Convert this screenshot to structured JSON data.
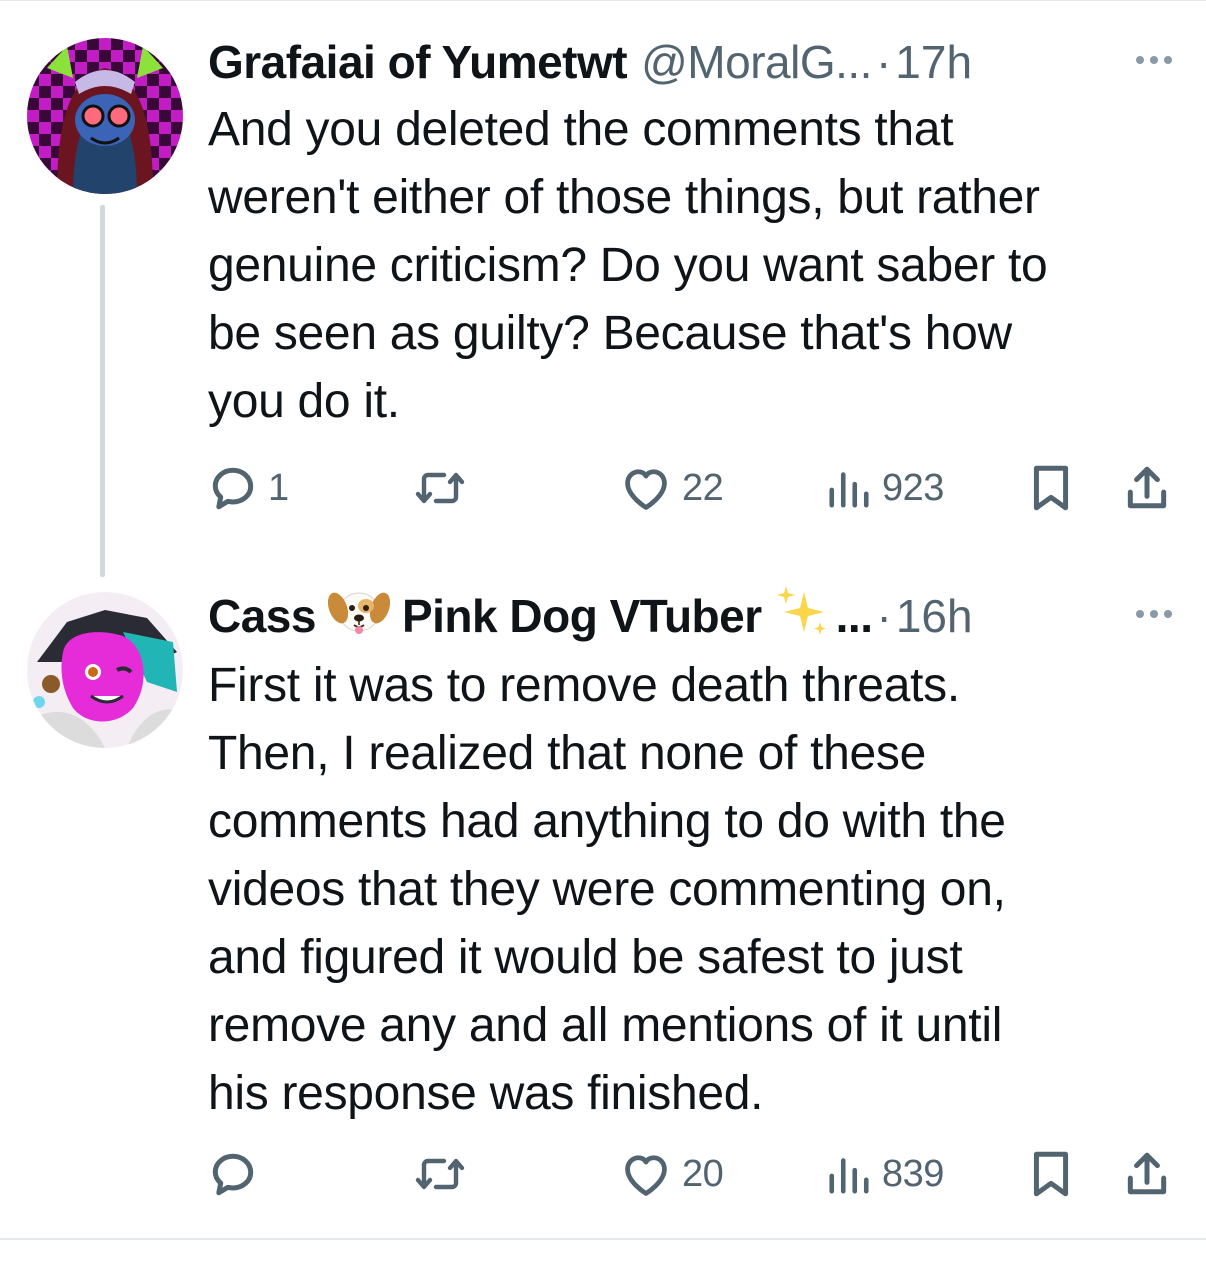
{
  "tweets": [
    {
      "name": "Grafaiai of Yumetwt",
      "handle": "@MoralG...",
      "separator": "·",
      "time": "17h",
      "text": "And you deleted the comments that\nweren't either of those things, but rather\ngenuine criticism? Do you want saber to\nbe seen as guilty? Because that's how\nyou do it.",
      "replies": "1",
      "retweets": "",
      "likes": "22",
      "views": "923"
    },
    {
      "name_part1": "Cass",
      "emoji_name": "dog-face-emoji",
      "name_part2": "Pink Dog VTuber",
      "name_suffix": "...",
      "separator": "·",
      "time": "16h",
      "text": "First it was to remove death threats.\nThen, I realized that none of these\ncomments had anything to do with the\nvideos that they were commenting on,\nand figured it would be safest to just\nremove any and all mentions of it until\nhis response was finished.",
      "replies": "",
      "retweets": "",
      "likes": "20",
      "views": "839"
    }
  ],
  "colors": {
    "text": "#0f1419",
    "secondary": "#536471",
    "divider": "#e6e9ec",
    "thread_line": "#cfd9de"
  },
  "icons": [
    "reply-icon",
    "retweet-icon",
    "like-icon",
    "views-icon",
    "bookmark-icon",
    "share-icon",
    "more-icon",
    "sparkles-emoji"
  ]
}
